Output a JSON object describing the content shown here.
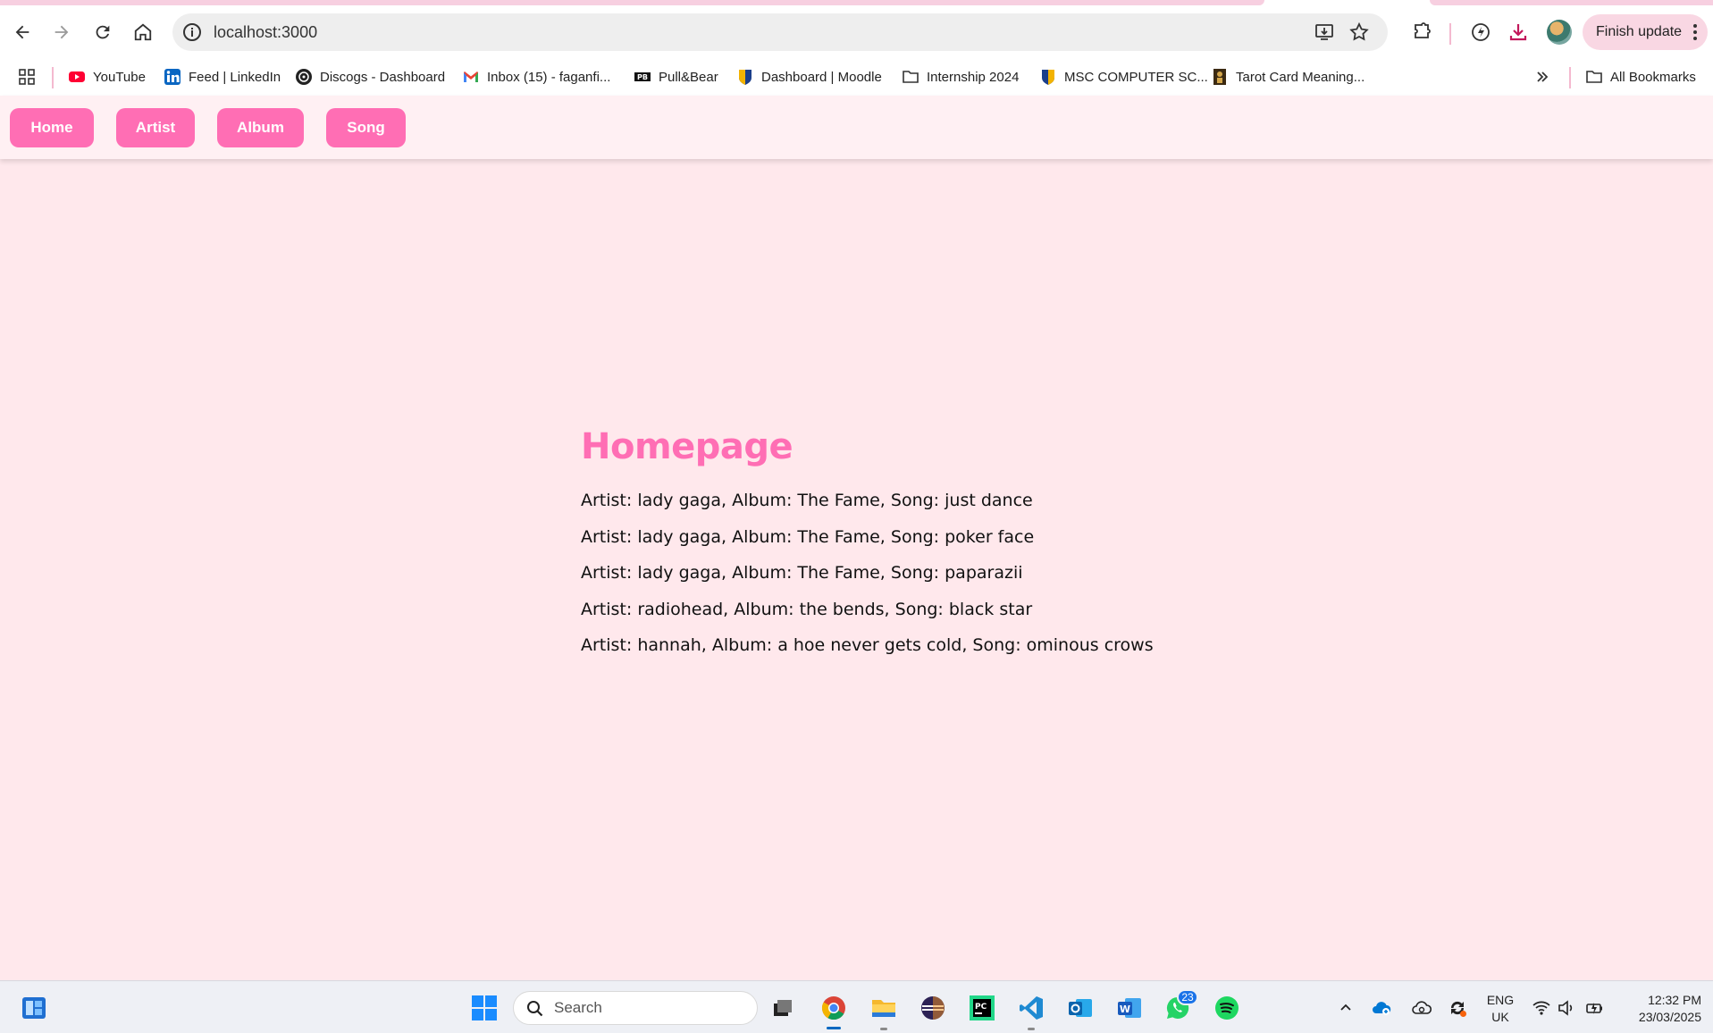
{
  "browser": {
    "url": "localhost:3000",
    "finish_update_label": "Finish update",
    "bookmarks": [
      {
        "label": "YouTube",
        "icon": "youtube-icon"
      },
      {
        "label": "Feed | LinkedIn",
        "icon": "linkedin-icon"
      },
      {
        "label": "Discogs - Dashboard",
        "icon": "discogs-icon"
      },
      {
        "label": "Inbox (15) - faganfi...",
        "icon": "gmail-icon"
      },
      {
        "label": "Pull&Bear",
        "icon": "pullbear-icon"
      },
      {
        "label": "Dashboard | Moodle",
        "icon": "moodle-icon"
      },
      {
        "label": "Internship 2024",
        "icon": "folder-icon"
      },
      {
        "label": "MSC COMPUTER SC...",
        "icon": "university-icon"
      },
      {
        "label": "Tarot Card Meaning...",
        "icon": "tarot-icon"
      }
    ],
    "all_bookmarks_label": "All Bookmarks"
  },
  "site": {
    "nav": [
      {
        "label": "Home"
      },
      {
        "label": "Artist"
      },
      {
        "label": "Album"
      },
      {
        "label": "Song"
      }
    ],
    "title": "Homepage",
    "entries": [
      "Artist: lady gaga, Album: The Fame, Song: just dance",
      "Artist: lady gaga, Album: The Fame, Song: poker face",
      "Artist: lady gaga, Album: The Fame, Song: paparazii",
      "Artist: radiohead, Album: the bends, Song: black star",
      "Artist: hannah, Album: a hoe never gets cold, Song: ominous crows"
    ]
  },
  "taskbar": {
    "search_placeholder": "Search",
    "whatsapp_badge": "23",
    "language_line1": "ENG",
    "language_line2": "UK",
    "time": "12:32 PM",
    "date": "23/03/2025"
  },
  "colors": {
    "accent": "#ff6eb4",
    "page_background": "#ffe8ec",
    "nav_background": "#fff0f3"
  }
}
